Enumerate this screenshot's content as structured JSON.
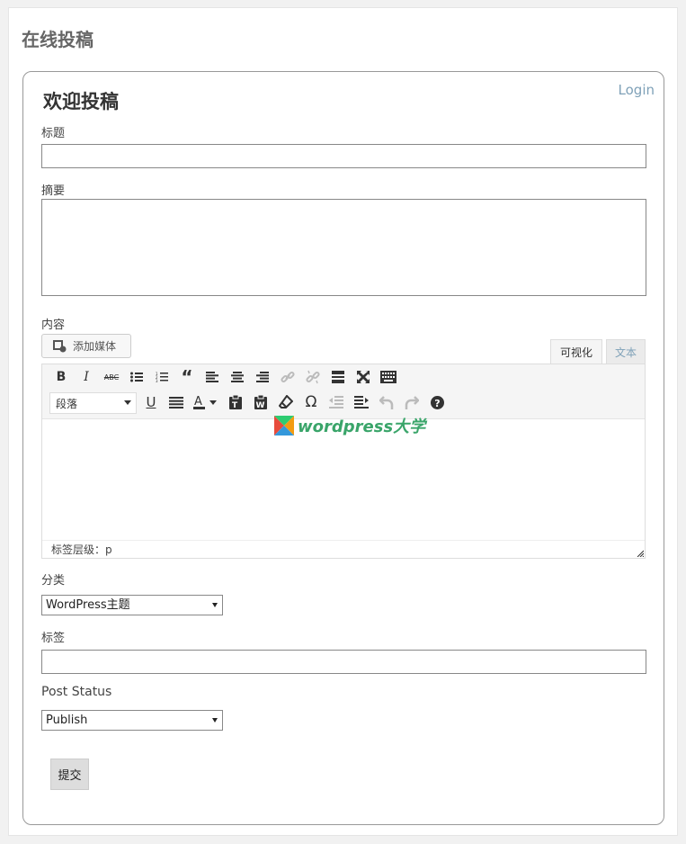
{
  "page": {
    "title": "在线投稿"
  },
  "form": {
    "heading": "欢迎投稿",
    "login_link": "Login",
    "title_label": "标题",
    "title_value": "",
    "excerpt_label": "摘要",
    "excerpt_value": "",
    "content_label": "内容",
    "add_media_label": "添加媒体",
    "tabs": {
      "visual": "可视化",
      "text": "文本"
    },
    "paragraph_format": "段落",
    "status_path": "标签层级：p",
    "watermark_text": "wordpress大学",
    "category_label": "分类",
    "category_value": "WordPress主题",
    "tags_label": "标签",
    "tags_value": "",
    "post_status_label": "Post Status",
    "post_status_value": "Publish",
    "submit_label": "提交"
  },
  "toolbar_row1": [
    "bold-icon",
    "italic-icon",
    "strikethrough-icon",
    "bulleted-list-icon",
    "numbered-list-icon",
    "blockquote-icon",
    "align-left-icon",
    "align-center-icon",
    "align-right-icon",
    "insert-link-icon",
    "remove-link-icon",
    "read-more-icon",
    "fullscreen-icon",
    "toolbar-toggle-icon"
  ],
  "toolbar_row2": [
    "underline-icon",
    "justify-icon",
    "text-color-icon",
    "paste-text-icon",
    "paste-word-icon",
    "clear-format-icon",
    "special-char-icon",
    "outdent-icon",
    "indent-icon",
    "undo-icon",
    "redo-icon",
    "help-icon"
  ],
  "colors": {
    "link": "#7fa1b8",
    "brand_green": "#3aa56a"
  }
}
